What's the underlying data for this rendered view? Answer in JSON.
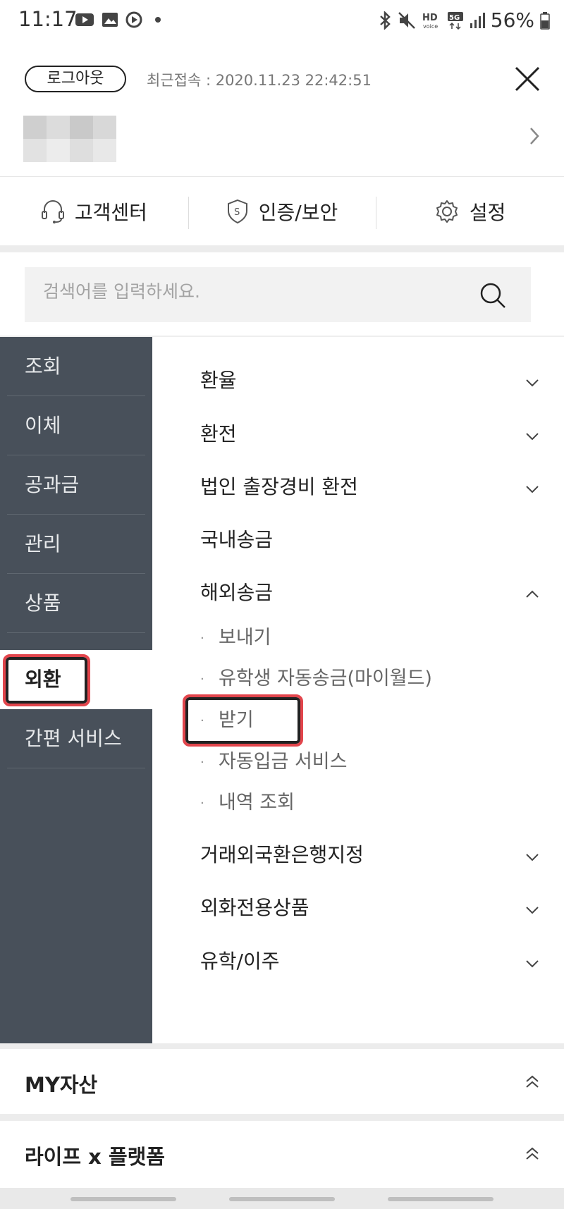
{
  "status_bar": {
    "time": "11:17",
    "battery": "56%",
    "indicators": [
      "youtube-icon",
      "gallery-icon",
      "play-icon",
      "bluetooth-icon",
      "mute-icon",
      "hd-voice-icon",
      "5g-icon",
      "signal-icon",
      "battery-icon"
    ]
  },
  "header": {
    "logout_label": "로그아웃",
    "last_login_label": "최근접속 : 2020.11.23 22:42:51"
  },
  "quick_menu": [
    {
      "label": "고객센터",
      "icon": "headset-icon"
    },
    {
      "label": "인증/보안",
      "icon": "shield-icon"
    },
    {
      "label": "설정",
      "icon": "gear-icon"
    }
  ],
  "search": {
    "placeholder": "검색어를 입력하세요."
  },
  "categories": [
    {
      "label": "조회",
      "active": false
    },
    {
      "label": "이체",
      "active": false
    },
    {
      "label": "공과금",
      "active": false
    },
    {
      "label": "관리",
      "active": false
    },
    {
      "label": "상품",
      "active": false
    },
    {
      "label": "외환",
      "active": true,
      "highlighted": true
    },
    {
      "label": "간편 서비스",
      "active": false
    }
  ],
  "sub_menu": {
    "items": [
      {
        "label": "환율",
        "chevron": "down"
      },
      {
        "label": "환전",
        "chevron": "down"
      },
      {
        "label": "법인 출장경비 환전",
        "chevron": "down"
      },
      {
        "label": "국내송금",
        "chevron": "none"
      },
      {
        "label": "해외송금",
        "chevron": "up"
      },
      {
        "label": "거래외국환은행지정",
        "chevron": "down"
      },
      {
        "label": "외화전용상품",
        "chevron": "down"
      },
      {
        "label": "유학/이주",
        "chevron": "down"
      }
    ],
    "overseas_children": [
      {
        "label": "보내기",
        "highlighted": false
      },
      {
        "label": "유학생 자동송금(마이월드)",
        "highlighted": false
      },
      {
        "label": "받기",
        "highlighted": true
      },
      {
        "label": "자동입금 서비스",
        "highlighted": false
      },
      {
        "label": "내역 조회",
        "highlighted": false
      }
    ]
  },
  "sections": [
    {
      "title": "MY자산"
    },
    {
      "title": "라이프 x 플랫폼"
    }
  ],
  "colors": {
    "nav_bg": "#48505a",
    "highlight": "#e2454c",
    "band": "#ececec"
  }
}
